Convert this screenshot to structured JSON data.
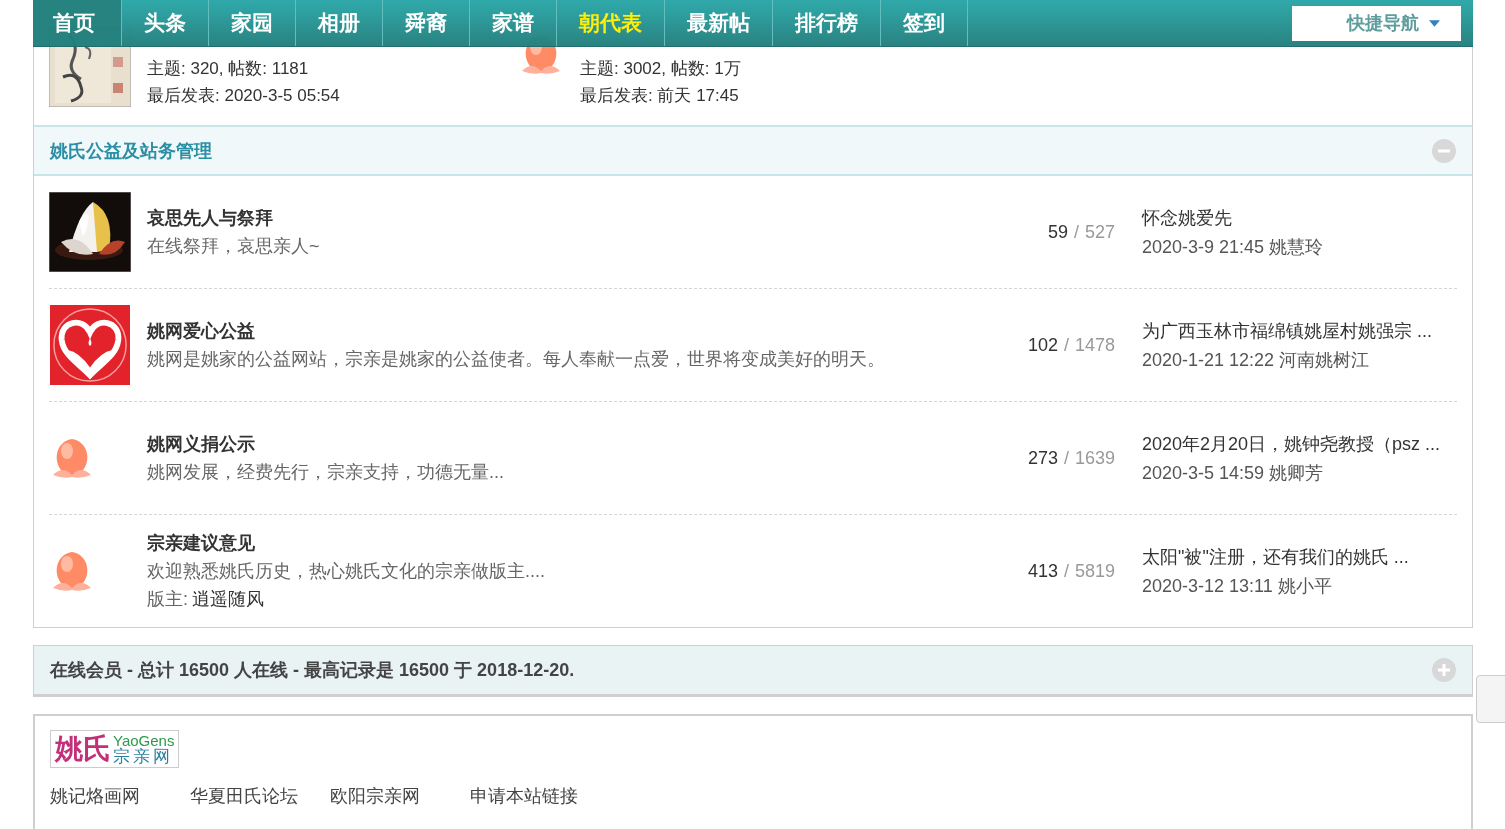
{
  "nav": {
    "items": [
      {
        "label": "首页",
        "selected": true,
        "highlighted": false
      },
      {
        "label": "头条",
        "selected": false,
        "highlighted": false
      },
      {
        "label": "家园",
        "selected": false,
        "highlighted": false
      },
      {
        "label": "相册",
        "selected": false,
        "highlighted": false
      },
      {
        "label": "舜裔",
        "selected": false,
        "highlighted": false
      },
      {
        "label": "家谱",
        "selected": false,
        "highlighted": false
      },
      {
        "label": "朝代表",
        "selected": false,
        "highlighted": true
      },
      {
        "label": "最新帖",
        "selected": false,
        "highlighted": false
      },
      {
        "label": "排行榜",
        "selected": false,
        "highlighted": false
      },
      {
        "label": "签到",
        "selected": false,
        "highlighted": false
      }
    ],
    "quick_nav": "快捷导航"
  },
  "top_forums": [
    {
      "kind": "calligraphy",
      "stats": "主题: 320, 帖数: 1181",
      "last_post": "最后发表: 2020-3-5 05:54"
    },
    {
      "kind": "peach",
      "stats": "主题: 3002, 帖数: 1万",
      "last_post": "最后发表: 前天 17:45"
    }
  ],
  "section": {
    "title": "姚氏公益及站务管理",
    "expanded": true,
    "forums": [
      {
        "kind": "lotus",
        "title": "哀思先人与祭拜",
        "description": "在线祭拜，哀思亲人~",
        "threads": "59",
        "separator": "/",
        "posts": "527",
        "last_title": "怀念姚爱先",
        "last_info": "2020-3-9 21:45 姚慧玲"
      },
      {
        "kind": "heart",
        "title": "姚网爱心公益",
        "description": "姚网是姚家的公益网站，宗亲是姚家的公益使者。每人奉献一点爱，世界将变成美好的明天。",
        "threads": "102",
        "separator": "/",
        "posts": "1478",
        "last_title": "为广西玉林市福绵镇姚屋村姚强宗 ...",
        "last_info": "2020-1-21 12:22 河南姚树江"
      },
      {
        "kind": "peach",
        "title": "姚网义捐公示",
        "description": "姚网发展，经费先行，宗亲支持，功德无量...",
        "threads": "273",
        "separator": "/",
        "posts": "1639",
        "last_title": "2020年2月20日，姚钟尧教授（psz ...",
        "last_info": "2020-3-5 14:59 姚卿芳"
      },
      {
        "kind": "peach",
        "title": "宗亲建议意见",
        "description": "欢迎熟悉姚氏历史，热心姚氏文化的宗亲做版主....",
        "moderator_label": "版主:",
        "moderator": "逍遥随风",
        "threads": "413",
        "separator": "/",
        "posts": "5819",
        "last_title": "太阳\"被\"注册，还有我们的姚氏 ...",
        "last_info": "2020-3-12 13:11 姚小平"
      }
    ]
  },
  "online": {
    "text": "在线会员 - 总计 16500 人在线 - 最高记录是 16500 于 2018-12-20.",
    "expanded": false
  },
  "links": {
    "logo": {
      "main": "姚氏",
      "latin": "YaoGens",
      "sub": "宗亲网"
    },
    "items": [
      "姚记烙画网",
      "华夏田氏论坛",
      "欧阳宗亲网",
      "申请本站链接"
    ]
  }
}
